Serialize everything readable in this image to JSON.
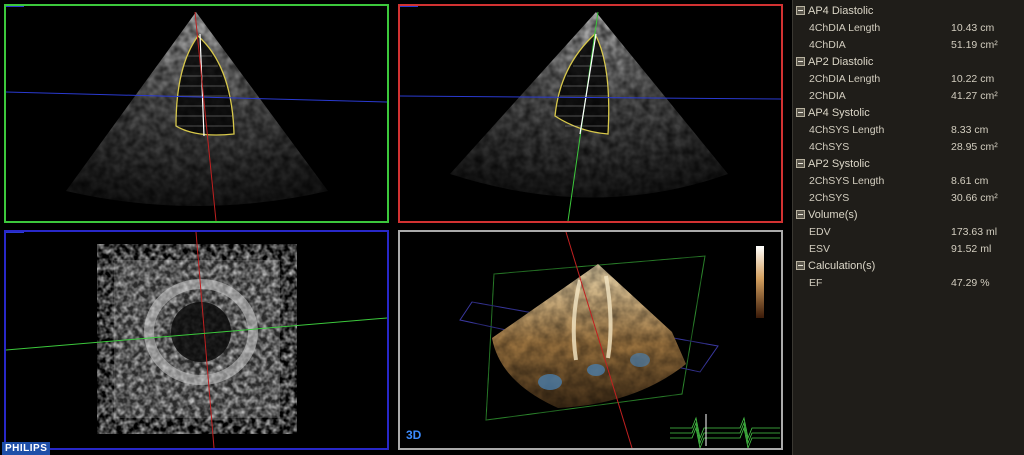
{
  "brand": "PHILIPS",
  "viewports": {
    "three_d_label": "3D"
  },
  "colors": {
    "ap4_frame": "#3cc83c",
    "ap2_frame": "#d23232",
    "sax_frame": "#2828c8",
    "render_frame": "#aaaaaa",
    "trace": "#d8c84a"
  },
  "measurements": [
    {
      "title": "AP4 Diastolic",
      "rows": [
        {
          "label": "4ChDIA Length",
          "value": "10.43 cm"
        },
        {
          "label": "4ChDIA",
          "value": "51.19 cm²"
        }
      ]
    },
    {
      "title": "AP2 Diastolic",
      "rows": [
        {
          "label": "2ChDIA Length",
          "value": "10.22 cm"
        },
        {
          "label": "2ChDIA",
          "value": "41.27 cm²"
        }
      ]
    },
    {
      "title": "AP4 Systolic",
      "rows": [
        {
          "label": "4ChSYS Length",
          "value": "8.33 cm"
        },
        {
          "label": "4ChSYS",
          "value": "28.95 cm²"
        }
      ]
    },
    {
      "title": "AP2 Systolic",
      "rows": [
        {
          "label": "2ChSYS Length",
          "value": "8.61 cm"
        },
        {
          "label": "2ChSYS",
          "value": "30.66 cm²"
        }
      ]
    },
    {
      "title": "Volume(s)",
      "rows": [
        {
          "label": "EDV",
          "value": "173.63 ml"
        },
        {
          "label": "ESV",
          "value": "91.52 ml"
        }
      ]
    },
    {
      "title": "Calculation(s)",
      "rows": [
        {
          "label": "EF",
          "value": "47.29 %"
        }
      ]
    }
  ]
}
